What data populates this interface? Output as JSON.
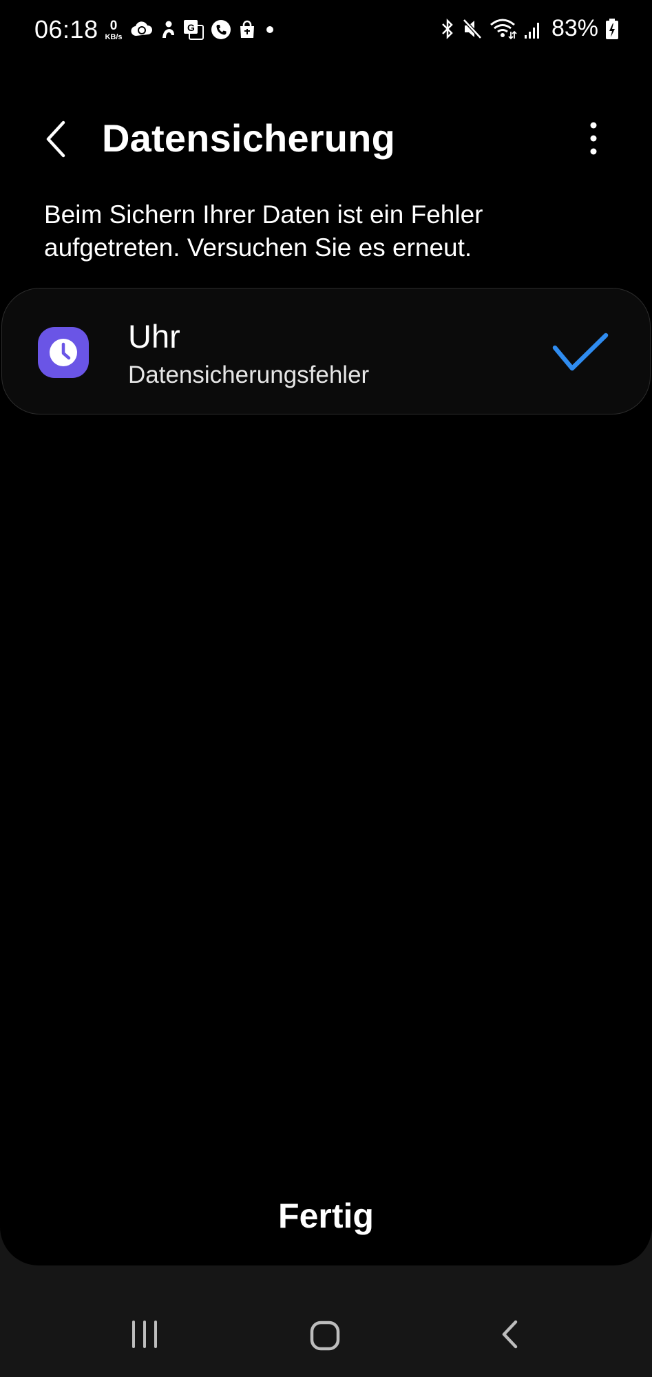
{
  "status_bar": {
    "time": "06:18",
    "net_speed_value": "0",
    "net_speed_unit": "KB/s",
    "battery": "83%",
    "left_icons": [
      "cloud-sync-icon",
      "person-icon",
      "translate-icon",
      "phone-icon",
      "shopping-bag-icon",
      "dot-icon"
    ],
    "right_icons": [
      "bluetooth-icon",
      "mute-icon",
      "wifi-icon",
      "signal-icon",
      "battery-charging-icon"
    ]
  },
  "header": {
    "title": "Datensicherung"
  },
  "message": "Beim Sichern Ihrer Daten ist ein Fehler aufgetreten. Versuchen Sie es erneut.",
  "items": [
    {
      "name": "Uhr",
      "status": "Datensicherungsfehler",
      "icon": "clock-icon",
      "checked": true
    }
  ],
  "done_label": "Fertig",
  "colors": {
    "accent": "#2f8cf0",
    "app_icon_bg": "#6a55e6",
    "background": "#000000"
  }
}
